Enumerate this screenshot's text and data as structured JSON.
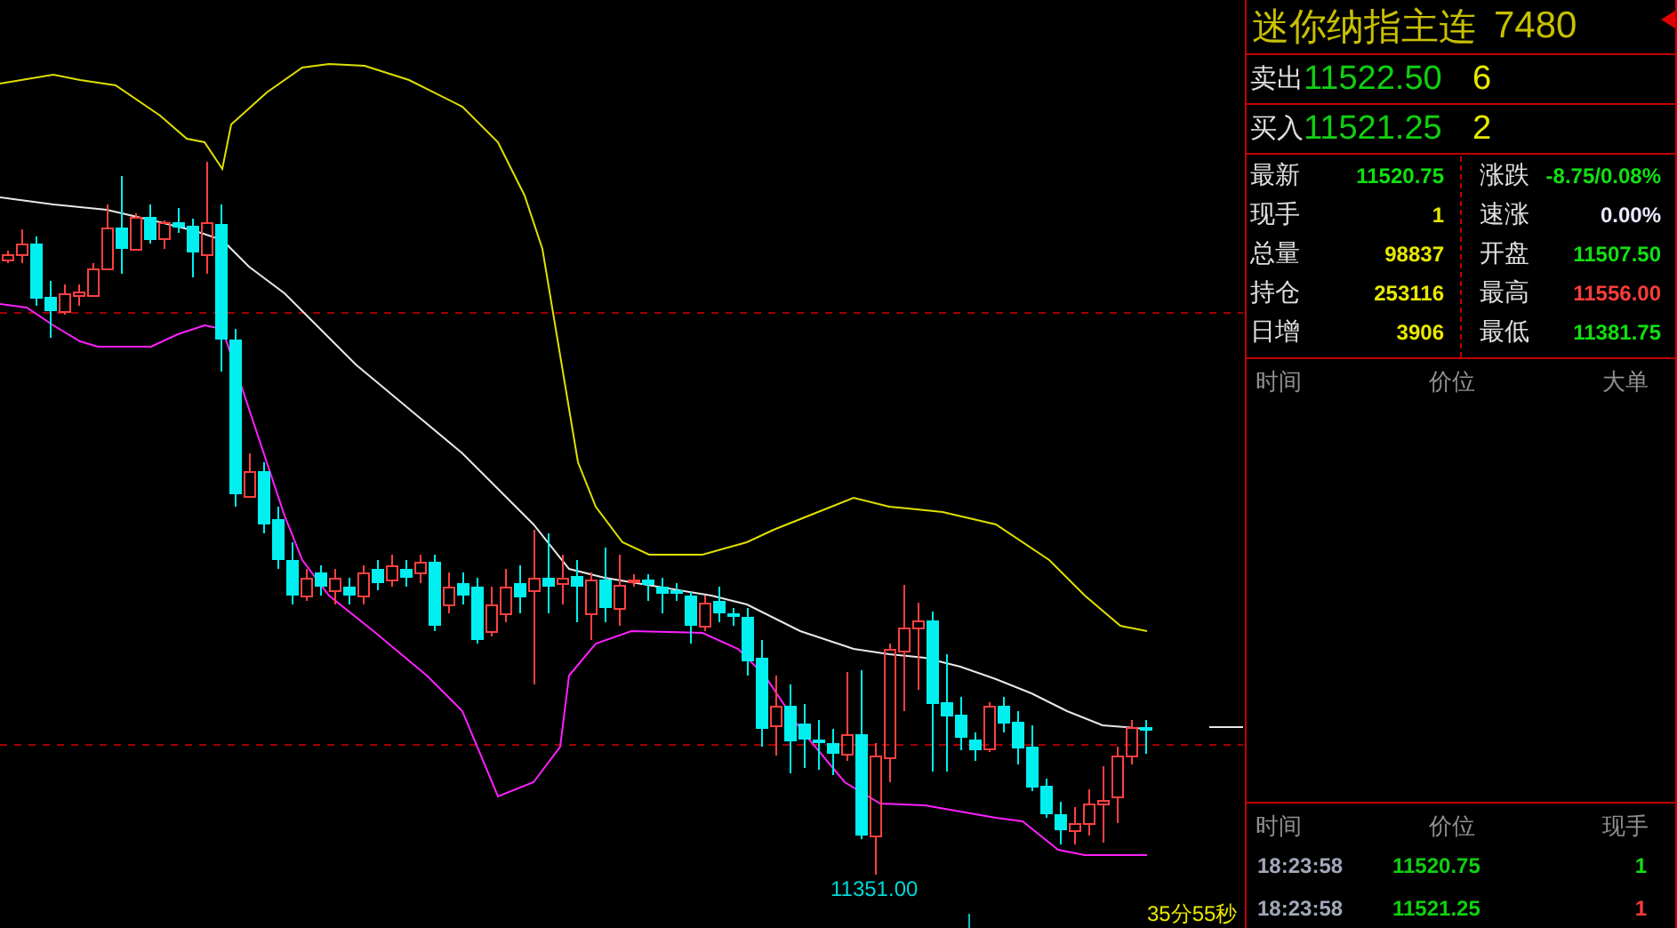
{
  "chart": {
    "low_label": "11351.00",
    "countdown": "35分55秒"
  },
  "quote": {
    "title": "迷你纳指主连",
    "code": "7480"
  },
  "ask": {
    "label": "卖出",
    "price": "11522.50",
    "volume": "6"
  },
  "bid": {
    "label": "买入",
    "price": "11521.25",
    "volume": "2"
  },
  "stats": {
    "left": [
      {
        "label": "最新",
        "value": "11520.75",
        "color": "#10e010"
      },
      {
        "label": "现手",
        "value": "1",
        "color": "#e8e800"
      },
      {
        "label": "总量",
        "value": "98837",
        "color": "#e8e800"
      },
      {
        "label": "持仓",
        "value": "253116",
        "color": "#e8e800"
      },
      {
        "label": "日增",
        "value": "3906",
        "color": "#e8e800"
      }
    ],
    "right": [
      {
        "label": "涨跌",
        "value": "-8.75/0.08%",
        "color": "#10e010"
      },
      {
        "label": "速涨",
        "value": "0.00%",
        "color": "#e8e8ff"
      },
      {
        "label": "开盘",
        "value": "11507.50",
        "color": "#10e010"
      },
      {
        "label": "最高",
        "value": "11556.00",
        "color": "#ff3c3c"
      },
      {
        "label": "最低",
        "value": "11381.75",
        "color": "#10e010"
      }
    ]
  },
  "big_orders": {
    "columns": [
      "时间",
      "价位",
      "大单"
    ]
  },
  "ticks": {
    "columns": [
      "时间",
      "价位",
      "现手"
    ],
    "rows": [
      {
        "time": "18:23:58",
        "price": "11520.75",
        "volume": "1",
        "color": "#10e010"
      },
      {
        "time": "18:23:58",
        "price": "11521.25",
        "volume": "1",
        "color": "#ff3c3c"
      }
    ]
  }
}
